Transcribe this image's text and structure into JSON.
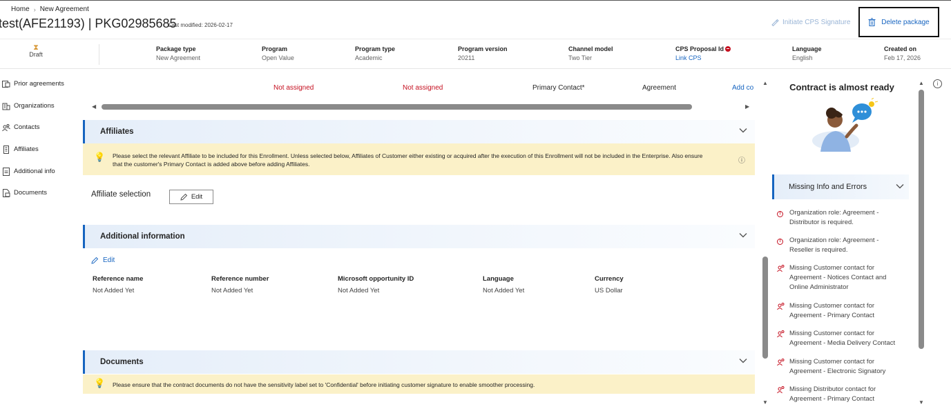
{
  "breadcrumb": {
    "home": "Home",
    "current": "New Agreement"
  },
  "header": {
    "title": "test(AFE21193) | PKG02985685",
    "last_modified": "Last modified: 2026-02-17",
    "initiate_label": "Initiate CPS Signature",
    "delete_label": "Delete package"
  },
  "summary": {
    "status": "Draft",
    "fields": [
      {
        "label": "Package type",
        "value": "New Agreement"
      },
      {
        "label": "Program",
        "value": "Open Value"
      },
      {
        "label": "Program type",
        "value": "Academic"
      },
      {
        "label": "Program version",
        "value": "20211"
      },
      {
        "label": "Channel model",
        "value": "Two Tier"
      },
      {
        "label": "CPS Proposal Id",
        "value": "Link CPS"
      },
      {
        "label": "Language",
        "value": "English"
      },
      {
        "label": "Created on",
        "value": "Feb 17, 2026"
      }
    ]
  },
  "nav": {
    "items": [
      {
        "label": "Prior agreements",
        "icon": "prior-agreements-icon"
      },
      {
        "label": "Organizations",
        "icon": "organizations-icon"
      },
      {
        "label": "Contacts",
        "icon": "contacts-icon"
      },
      {
        "label": "Affiliates",
        "icon": "affiliates-icon"
      },
      {
        "label": "Additional info",
        "icon": "additional-info-icon"
      },
      {
        "label": "Documents",
        "icon": "documents-icon"
      }
    ]
  },
  "contacts_row": {
    "cells": [
      "Not assigned",
      "Not assigned",
      "Primary Contact*",
      "Agreement",
      "Add co"
    ],
    "colors": {
      "not_assigned": "#c50f1f",
      "link": "#1664c0"
    }
  },
  "affiliates": {
    "title": "Affiliates",
    "notice_line1": "Please select the relevant Affiliate to be included for this Enrollment. Unless selected below, Affiliates of Customer either existing or acquired after the execution of this Enrollment will not be included in the Enterprise. Also ensure",
    "notice_line2": "that the customer's Primary Contact is added above before adding Affiliates.",
    "selection_label": "Affiliate selection",
    "edit_label": "Edit"
  },
  "additional": {
    "title": "Additional information",
    "edit_label": "Edit",
    "columns": [
      {
        "header": "Reference name",
        "value": "Not Added Yet"
      },
      {
        "header": "Reference number",
        "value": "Not Added Yet"
      },
      {
        "header": "Microsoft opportunity ID",
        "value": "Not Added Yet"
      },
      {
        "header": "Language",
        "value": "Not Added Yet"
      },
      {
        "header": "Currency",
        "value": "US Dollar"
      }
    ]
  },
  "documents": {
    "title": "Documents",
    "notice": "Please ensure that the contract documents do not have the sensitivity label set to 'Confidential' before initiating customer signature to enable smoother processing."
  },
  "right_panel": {
    "ready_title": "Contract is almost ready",
    "missing_title": "Missing Info and Errors",
    "issues": [
      {
        "type": "error",
        "line1": "Organization role: Agreement -",
        "line2": "Distributor is required.",
        "line3": ""
      },
      {
        "type": "error",
        "line1": "Organization role: Agreement -",
        "line2": "Reseller is required.",
        "line3": ""
      },
      {
        "type": "contact",
        "line1": "Missing Customer contact for",
        "line2": "Agreement - Notices Contact and",
        "line3": "Online Administrator"
      },
      {
        "type": "contact",
        "line1": "Missing Customer contact for",
        "line2": "Agreement - Primary Contact",
        "line3": ""
      },
      {
        "type": "contact",
        "line1": "Missing Customer contact for",
        "line2": "Agreement - Media Delivery Contact",
        "line3": ""
      },
      {
        "type": "contact",
        "line1": "Missing Customer contact for",
        "line2": "Agreement - Electronic Signatory",
        "line3": ""
      },
      {
        "type": "contact",
        "line1": "Missing Distributor contact for",
        "line2": "Agreement - Primary Contact",
        "line3": ""
      }
    ]
  },
  "colors": {
    "accent": "#1664c0",
    "error": "#c50f1f",
    "notice_bg": "#fbf1c8"
  }
}
